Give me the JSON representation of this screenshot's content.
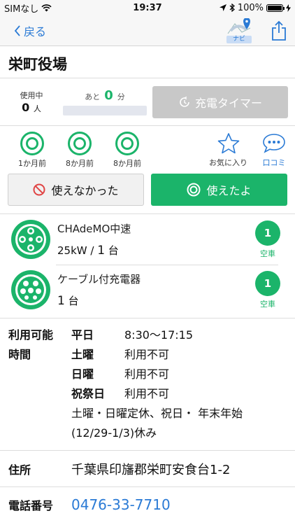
{
  "status_bar": {
    "carrier": "SIMなし",
    "time": "19:37",
    "battery": "100%"
  },
  "nav": {
    "back_label": "戻る",
    "navi_label": "ナビ"
  },
  "station": {
    "name": "栄町役場"
  },
  "usage": {
    "in_use_caption": "使用中",
    "in_use_count": "0",
    "in_use_unit": "人",
    "remain_prefix": "あと",
    "remain_value": "0",
    "remain_unit": "分",
    "timer_label": "充電タイマー"
  },
  "reports": [
    {
      "label": "1か月前"
    },
    {
      "label": "8か月前"
    },
    {
      "label": "8か月前"
    }
  ],
  "favorite_label": "お気に入り",
  "review_label": "口コミ",
  "actions": {
    "ng_label": "使えなかった",
    "ok_label": "使えたよ"
  },
  "connectors": [
    {
      "name": "CHAdeMO中速",
      "power": "25kW / ",
      "count": "1",
      "count_unit": " 台",
      "available": "1",
      "available_label": "空車"
    },
    {
      "name": "ケーブル付充電器",
      "power": "",
      "count": "1",
      "count_unit": " 台",
      "available": "1",
      "available_label": "空車"
    }
  ],
  "hours": {
    "label_line1": "利用可能",
    "label_line2": "時間",
    "rows": [
      {
        "day": "平日",
        "time": "8:30〜17:15"
      },
      {
        "day": "土曜",
        "time": "利用不可"
      },
      {
        "day": "日曜",
        "time": "利用不可"
      },
      {
        "day": "祝祭日",
        "time": "利用不可"
      }
    ],
    "note_line1": "土曜・日曜定休、祝日・ 年末年始",
    "note_line2": "(12/29-1/3)休み"
  },
  "address": {
    "label": "住所",
    "value": "千葉県印旛郡栄町安食台1-2"
  },
  "phone": {
    "label": "電話番号",
    "value": "0476-33-7710"
  },
  "colors": {
    "accent_green": "#1bb46a",
    "link_blue": "#2a7ad5",
    "disabled_gray": "#c8c8c8"
  }
}
